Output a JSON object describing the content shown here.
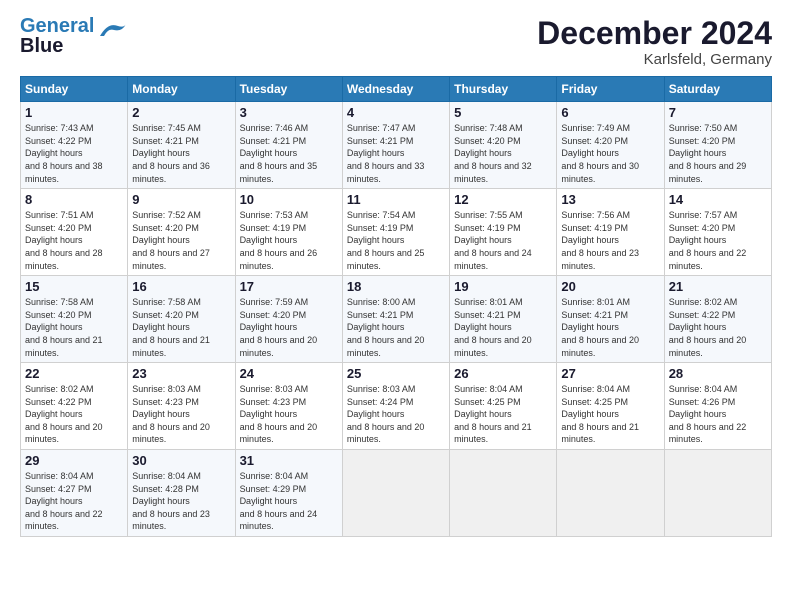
{
  "logo": {
    "line1": "General",
    "line2": "Blue"
  },
  "title": "December 2024",
  "subtitle": "Karlsfeld, Germany",
  "headers": [
    "Sunday",
    "Monday",
    "Tuesday",
    "Wednesday",
    "Thursday",
    "Friday",
    "Saturday"
  ],
  "weeks": [
    [
      {
        "day": "1",
        "sunrise": "7:43 AM",
        "sunset": "4:22 PM",
        "daylight": "8 hours and 38 minutes."
      },
      {
        "day": "2",
        "sunrise": "7:45 AM",
        "sunset": "4:21 PM",
        "daylight": "8 hours and 36 minutes."
      },
      {
        "day": "3",
        "sunrise": "7:46 AM",
        "sunset": "4:21 PM",
        "daylight": "8 hours and 35 minutes."
      },
      {
        "day": "4",
        "sunrise": "7:47 AM",
        "sunset": "4:21 PM",
        "daylight": "8 hours and 33 minutes."
      },
      {
        "day": "5",
        "sunrise": "7:48 AM",
        "sunset": "4:20 PM",
        "daylight": "8 hours and 32 minutes."
      },
      {
        "day": "6",
        "sunrise": "7:49 AM",
        "sunset": "4:20 PM",
        "daylight": "8 hours and 30 minutes."
      },
      {
        "day": "7",
        "sunrise": "7:50 AM",
        "sunset": "4:20 PM",
        "daylight": "8 hours and 29 minutes."
      }
    ],
    [
      {
        "day": "8",
        "sunrise": "7:51 AM",
        "sunset": "4:20 PM",
        "daylight": "8 hours and 28 minutes."
      },
      {
        "day": "9",
        "sunrise": "7:52 AM",
        "sunset": "4:20 PM",
        "daylight": "8 hours and 27 minutes."
      },
      {
        "day": "10",
        "sunrise": "7:53 AM",
        "sunset": "4:19 PM",
        "daylight": "8 hours and 26 minutes."
      },
      {
        "day": "11",
        "sunrise": "7:54 AM",
        "sunset": "4:19 PM",
        "daylight": "8 hours and 25 minutes."
      },
      {
        "day": "12",
        "sunrise": "7:55 AM",
        "sunset": "4:19 PM",
        "daylight": "8 hours and 24 minutes."
      },
      {
        "day": "13",
        "sunrise": "7:56 AM",
        "sunset": "4:19 PM",
        "daylight": "8 hours and 23 minutes."
      },
      {
        "day": "14",
        "sunrise": "7:57 AM",
        "sunset": "4:20 PM",
        "daylight": "8 hours and 22 minutes."
      }
    ],
    [
      {
        "day": "15",
        "sunrise": "7:58 AM",
        "sunset": "4:20 PM",
        "daylight": "8 hours and 21 minutes."
      },
      {
        "day": "16",
        "sunrise": "7:58 AM",
        "sunset": "4:20 PM",
        "daylight": "8 hours and 21 minutes."
      },
      {
        "day": "17",
        "sunrise": "7:59 AM",
        "sunset": "4:20 PM",
        "daylight": "8 hours and 20 minutes."
      },
      {
        "day": "18",
        "sunrise": "8:00 AM",
        "sunset": "4:21 PM",
        "daylight": "8 hours and 20 minutes."
      },
      {
        "day": "19",
        "sunrise": "8:01 AM",
        "sunset": "4:21 PM",
        "daylight": "8 hours and 20 minutes."
      },
      {
        "day": "20",
        "sunrise": "8:01 AM",
        "sunset": "4:21 PM",
        "daylight": "8 hours and 20 minutes."
      },
      {
        "day": "21",
        "sunrise": "8:02 AM",
        "sunset": "4:22 PM",
        "daylight": "8 hours and 20 minutes."
      }
    ],
    [
      {
        "day": "22",
        "sunrise": "8:02 AM",
        "sunset": "4:22 PM",
        "daylight": "8 hours and 20 minutes."
      },
      {
        "day": "23",
        "sunrise": "8:03 AM",
        "sunset": "4:23 PM",
        "daylight": "8 hours and 20 minutes."
      },
      {
        "day": "24",
        "sunrise": "8:03 AM",
        "sunset": "4:23 PM",
        "daylight": "8 hours and 20 minutes."
      },
      {
        "day": "25",
        "sunrise": "8:03 AM",
        "sunset": "4:24 PM",
        "daylight": "8 hours and 20 minutes."
      },
      {
        "day": "26",
        "sunrise": "8:04 AM",
        "sunset": "4:25 PM",
        "daylight": "8 hours and 21 minutes."
      },
      {
        "day": "27",
        "sunrise": "8:04 AM",
        "sunset": "4:25 PM",
        "daylight": "8 hours and 21 minutes."
      },
      {
        "day": "28",
        "sunrise": "8:04 AM",
        "sunset": "4:26 PM",
        "daylight": "8 hours and 22 minutes."
      }
    ],
    [
      {
        "day": "29",
        "sunrise": "8:04 AM",
        "sunset": "4:27 PM",
        "daylight": "8 hours and 22 minutes."
      },
      {
        "day": "30",
        "sunrise": "8:04 AM",
        "sunset": "4:28 PM",
        "daylight": "8 hours and 23 minutes."
      },
      {
        "day": "31",
        "sunrise": "8:04 AM",
        "sunset": "4:29 PM",
        "daylight": "8 hours and 24 minutes."
      },
      null,
      null,
      null,
      null
    ]
  ]
}
